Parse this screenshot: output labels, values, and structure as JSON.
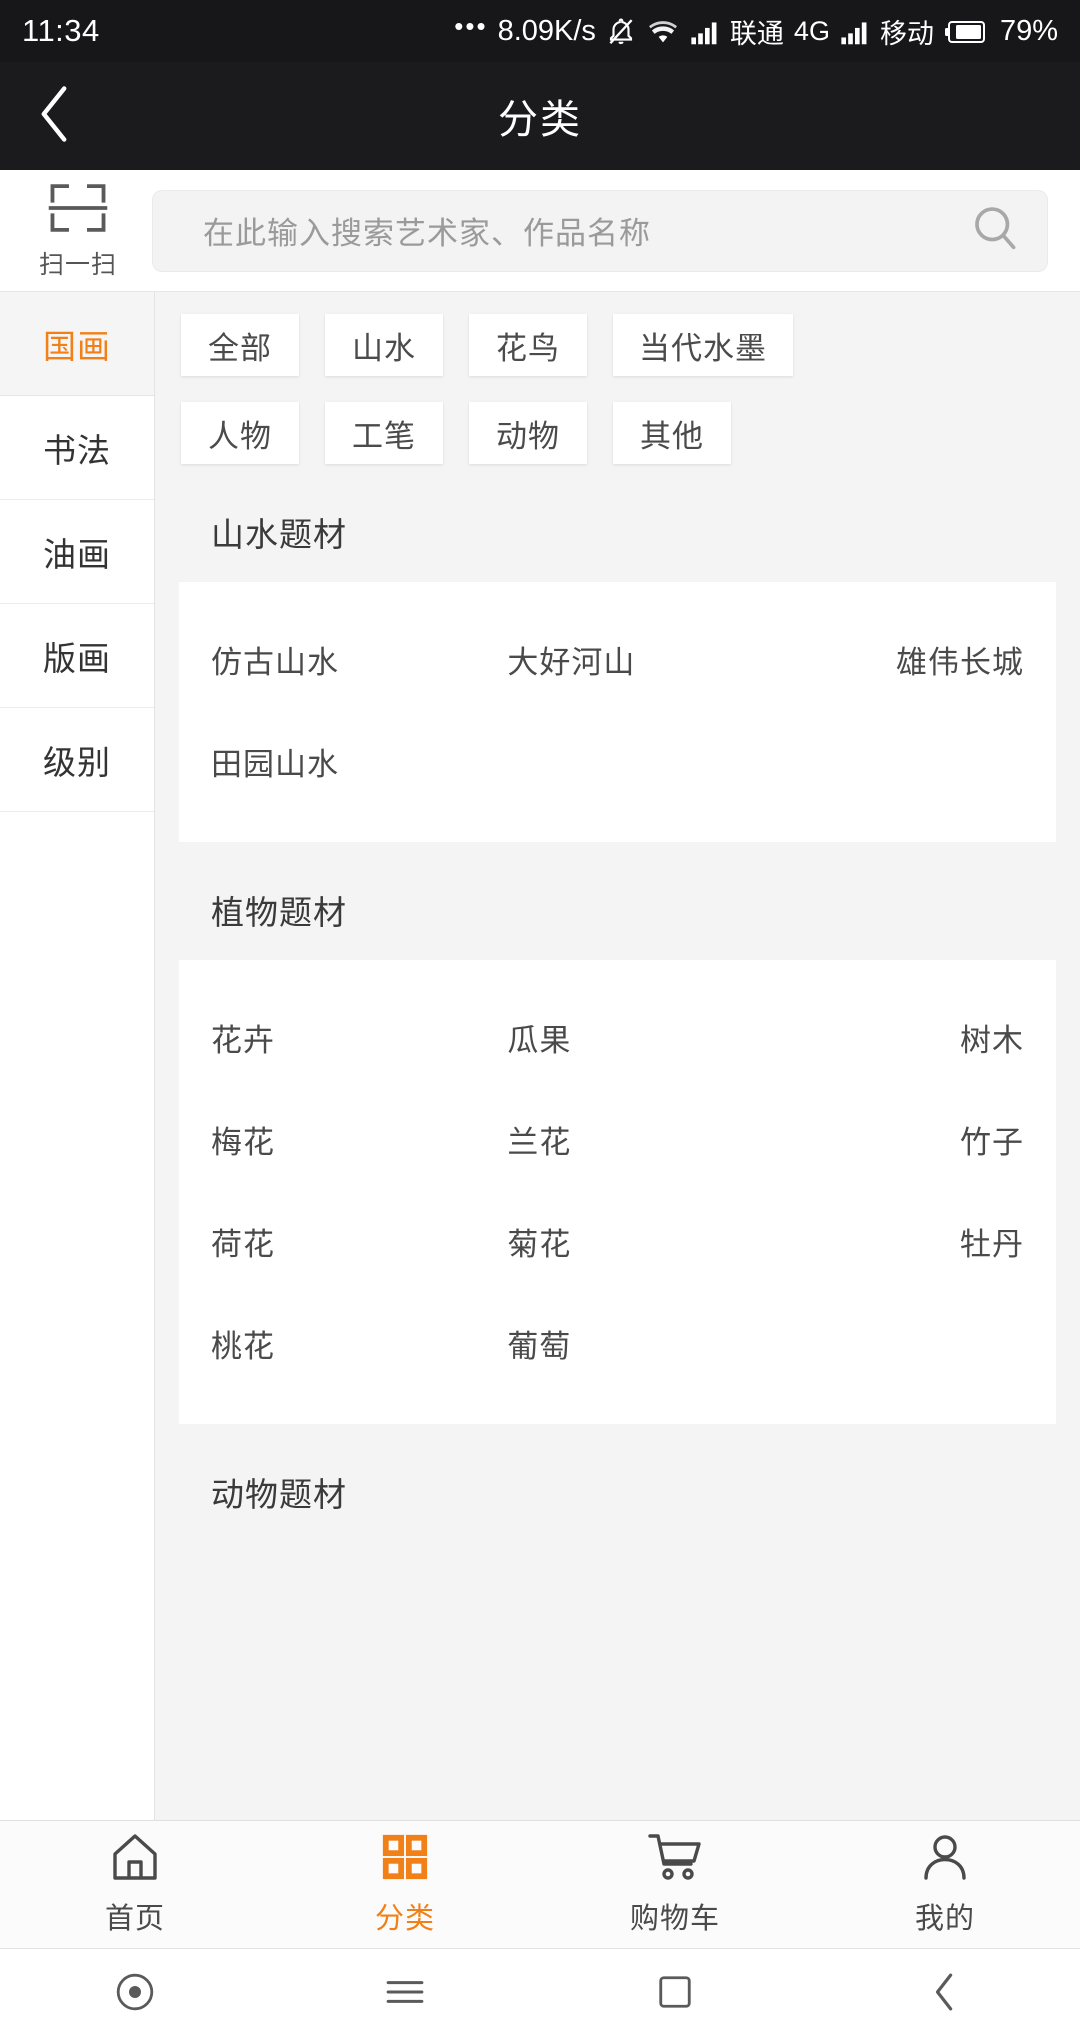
{
  "status_bar": {
    "time": "11:34",
    "dots": "•••",
    "network_speed": "8.09K/s",
    "carrier_1": "联通",
    "network_type": "4G",
    "carrier_2": "移动",
    "battery_percent": "79%"
  },
  "title_bar": {
    "title": "分类",
    "back_icon": "chevron-left-icon"
  },
  "search": {
    "scan_label": "扫一扫",
    "scan_icon": "scan-icon",
    "placeholder": "在此输入搜索艺术家、作品名称",
    "value": "",
    "search_icon": "magnifier-icon"
  },
  "sidebar": {
    "active_index": 0,
    "items": [
      {
        "label": "国画"
      },
      {
        "label": "书法"
      },
      {
        "label": "油画"
      },
      {
        "label": "版画"
      },
      {
        "label": "级别"
      }
    ]
  },
  "filters": {
    "row1": [
      {
        "label": "全部"
      },
      {
        "label": "山水"
      },
      {
        "label": "花鸟"
      },
      {
        "label": "当代水墨"
      }
    ],
    "row2": [
      {
        "label": "人物"
      },
      {
        "label": "工笔"
      },
      {
        "label": "动物"
      },
      {
        "label": "其他"
      }
    ]
  },
  "sections": [
    {
      "title": "山水题材",
      "items": [
        "仿古山水",
        "大好河山",
        "雄伟长城",
        "田园山水"
      ]
    },
    {
      "title": "植物题材",
      "items": [
        "花卉",
        "瓜果",
        "树木",
        "梅花",
        "兰花",
        "竹子",
        "荷花",
        "菊花",
        "牡丹",
        "桃花",
        "葡萄"
      ]
    },
    {
      "title": "动物题材",
      "items": []
    }
  ],
  "tabbar": {
    "active_index": 1,
    "accent_color": "#f08017",
    "items": [
      {
        "label": "首页",
        "icon": "home-icon"
      },
      {
        "label": "分类",
        "icon": "grid-icon"
      },
      {
        "label": "购物车",
        "icon": "cart-icon"
      },
      {
        "label": "我的",
        "icon": "person-icon"
      }
    ]
  },
  "android_nav": {
    "items": [
      {
        "icon": "circle-dot-icon"
      },
      {
        "icon": "menu-icon"
      },
      {
        "icon": "square-icon"
      },
      {
        "icon": "back-chevron-icon"
      }
    ]
  }
}
